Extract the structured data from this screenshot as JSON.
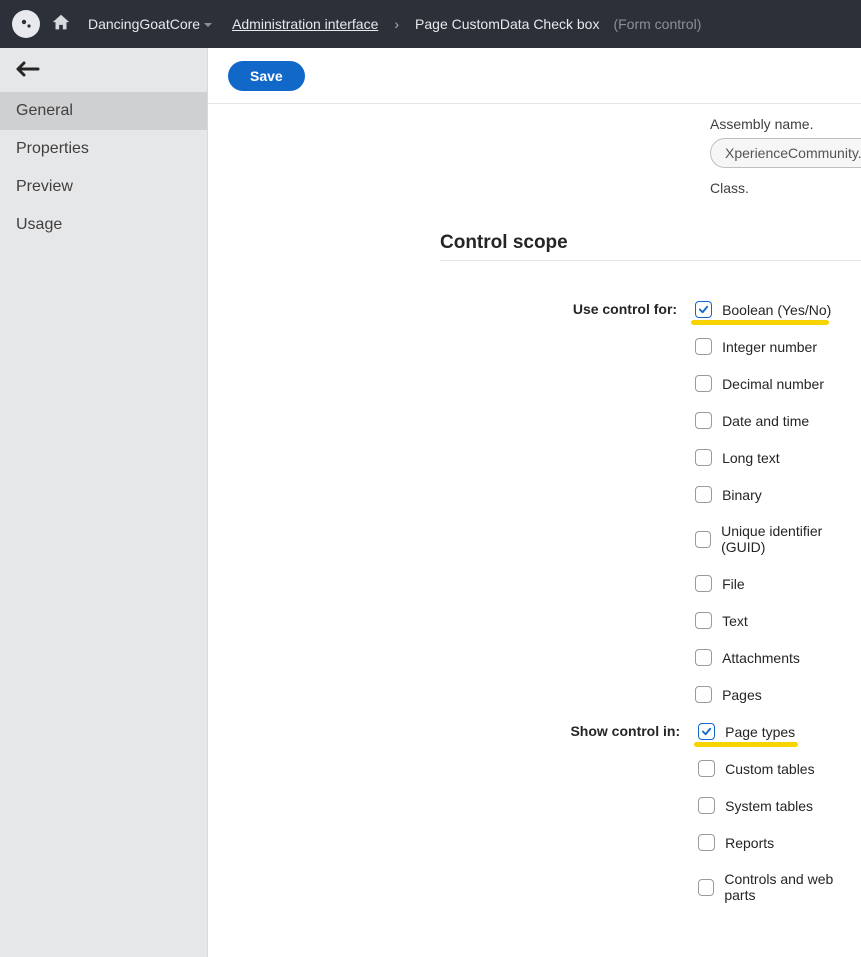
{
  "topbar": {
    "site_name": "DancingGoatCore",
    "crumb_admin": "Administration interface",
    "crumb_page": "Page CustomData Check box",
    "crumb_suffix": "(Form control)"
  },
  "sidebar": {
    "items": [
      {
        "label": "General",
        "active": true
      },
      {
        "label": "Properties",
        "active": false
      },
      {
        "label": "Preview",
        "active": false
      },
      {
        "label": "Usage",
        "active": false
      }
    ]
  },
  "toolbar": {
    "save_label": "Save"
  },
  "form": {
    "assembly_name_label": "Assembly name.",
    "assembly_name_value": "XperienceCommunity.PageCustomDataCon...",
    "class_label": "Class.",
    "section_title": "Control scope",
    "use_control_for_label": "Use control for:",
    "show_control_in_label": "Show control in:",
    "use_control_for": [
      {
        "label": "Boolean (Yes/No)",
        "checked": true,
        "highlight_width": 138
      },
      {
        "label": "Integer number",
        "checked": false
      },
      {
        "label": "Decimal number",
        "checked": false
      },
      {
        "label": "Date and time",
        "checked": false
      },
      {
        "label": "Long text",
        "checked": false
      },
      {
        "label": "Binary",
        "checked": false
      },
      {
        "label": "Unique identifier (GUID)",
        "checked": false
      },
      {
        "label": "File",
        "checked": false
      },
      {
        "label": "Text",
        "checked": false
      },
      {
        "label": "Attachments",
        "checked": false
      },
      {
        "label": "Pages",
        "checked": false
      }
    ],
    "show_control_in": [
      {
        "label": "Page types",
        "checked": true,
        "highlight_width": 104
      },
      {
        "label": "Custom tables",
        "checked": false
      },
      {
        "label": "System tables",
        "checked": false
      },
      {
        "label": "Reports",
        "checked": false
      },
      {
        "label": "Controls and web parts",
        "checked": false
      }
    ]
  }
}
